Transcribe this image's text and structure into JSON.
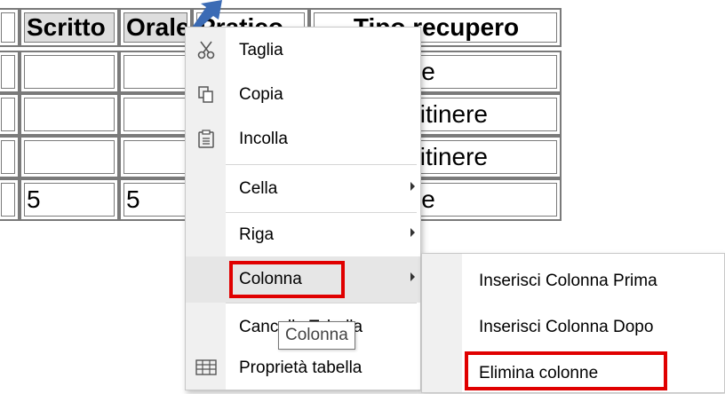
{
  "table": {
    "headers": [
      "Scritto",
      "Orale",
      "Pratico",
      "Tipo recupero"
    ],
    "rows": [
      [
        "",
        "",
        "",
        "Individuale"
      ],
      [
        "",
        "",
        "",
        "Studio in itinere"
      ],
      [
        "",
        "",
        "",
        "Studio in itinere"
      ],
      [
        "5",
        "5",
        "",
        "Individuale"
      ]
    ]
  },
  "context_menu": {
    "items": [
      {
        "label": "Taglia",
        "icon": "scissors-icon"
      },
      {
        "label": "Copia",
        "icon": "copy-icon"
      },
      {
        "label": "Incolla",
        "icon": "paste-icon"
      },
      {
        "label": "Cella",
        "submenu": true
      },
      {
        "label": "Riga",
        "submenu": true
      },
      {
        "label": "Colonna",
        "submenu": true,
        "active": true
      },
      {
        "label": "Cancella Tabella"
      },
      {
        "label": "Proprietà tabella",
        "icon": "table-icon"
      }
    ]
  },
  "submenu": {
    "items": [
      {
        "label": "Inserisci Colonna Prima"
      },
      {
        "label": "Inserisci Colonna Dopo"
      },
      {
        "label": "Elimina colonne"
      }
    ]
  },
  "tooltip": {
    "text": "Colonna"
  },
  "colors": {
    "highlight": "#e00000",
    "arrow": "#3b6bb5",
    "menu_gutter": "#f0f0f0"
  }
}
